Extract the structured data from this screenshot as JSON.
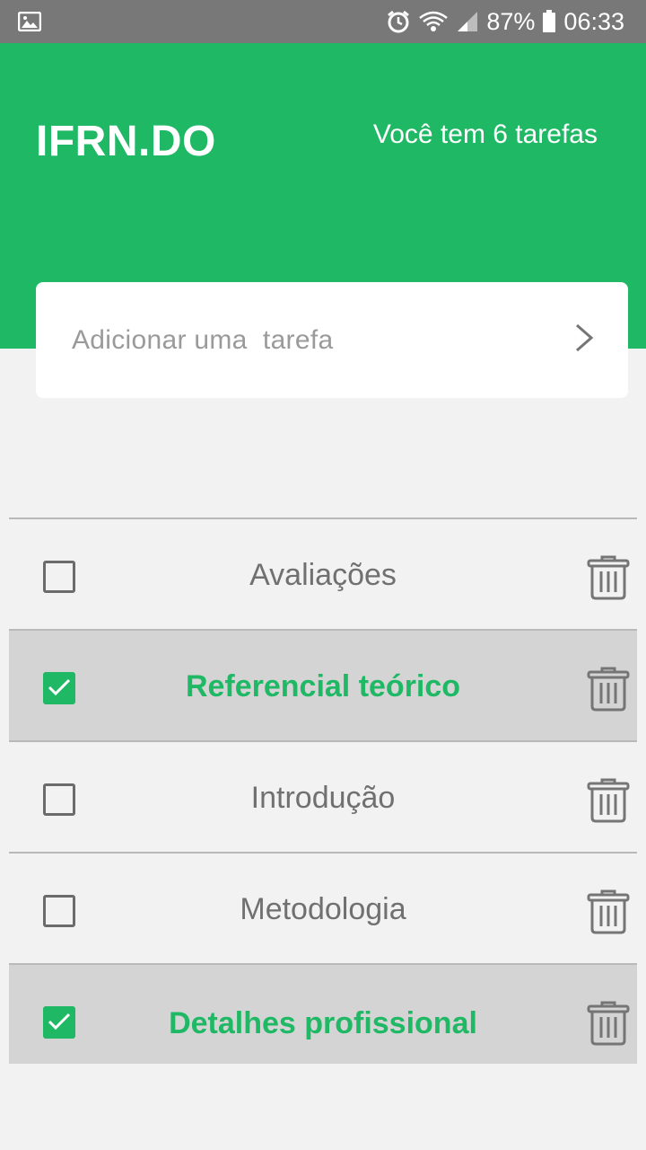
{
  "status_bar": {
    "battery": "87%",
    "time": "06:33",
    "icons": [
      "image-icon",
      "alarm-icon",
      "wifi-icon",
      "signal-icon",
      "battery-icon"
    ]
  },
  "header": {
    "title": "IFRN.DO",
    "task_count": "Você tem 6 tarefas",
    "color": "#1fb865"
  },
  "add_task": {
    "placeholder": "Adicionar uma  tarefa",
    "value": "",
    "submit_icon": "chevron-right-icon"
  },
  "tasks": [
    {
      "label": "Avaliações",
      "done": false
    },
    {
      "label": "Referencial teórico",
      "done": true
    },
    {
      "label": "Introdução",
      "done": false
    },
    {
      "label": "Metodologia",
      "done": false
    },
    {
      "label": "Detalhes profissional",
      "done": true
    }
  ],
  "colors": {
    "accent": "#1fb865",
    "done_row": "#d4d4d4",
    "background": "#f2f2f2"
  }
}
